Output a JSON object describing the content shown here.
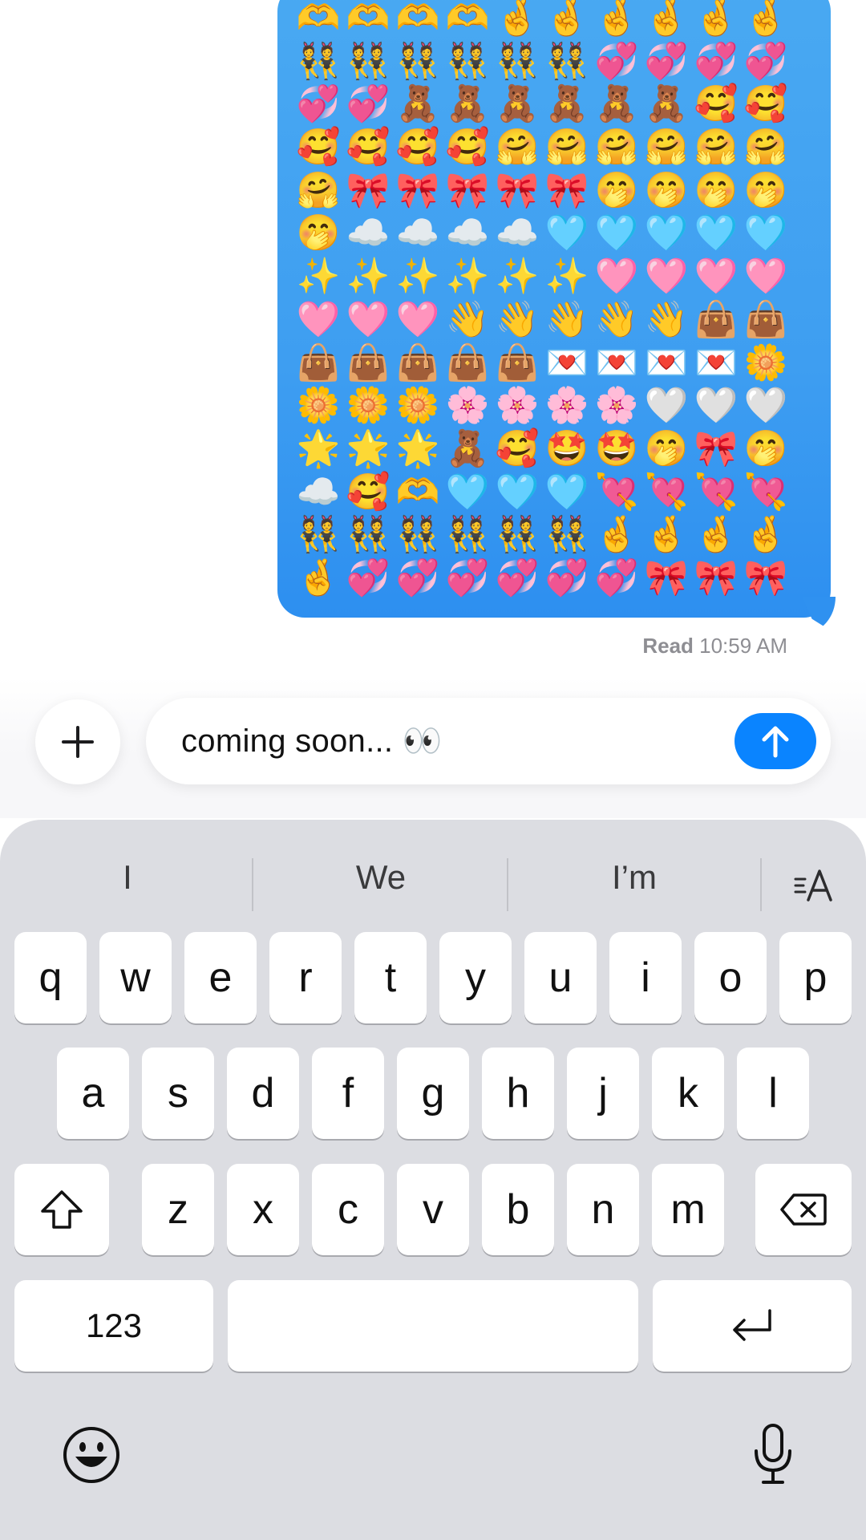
{
  "message": {
    "emoji_rows": [
      [
        "🫶",
        "🫶",
        "🫶",
        "🫶",
        "🤞",
        "🤞",
        "🤞",
        "🤞",
        "🤞",
        "🤞"
      ],
      [
        "👯",
        "👯",
        "👯",
        "👯",
        "👯",
        "👯",
        "💞",
        "💞",
        "💞",
        "💞"
      ],
      [
        "💞",
        "💞",
        "🧸",
        "🧸",
        "🧸",
        "🧸",
        "🧸",
        "🧸",
        "🥰",
        "🥰"
      ],
      [
        "🥰",
        "🥰",
        "🥰",
        "🥰",
        "🤗",
        "🤗",
        "🤗",
        "🤗",
        "🤗",
        "🤗"
      ],
      [
        "🤗",
        "🎀",
        "🎀",
        "🎀",
        "🎀",
        "🎀",
        "🤭",
        "🤭",
        "🤭",
        "🤭"
      ],
      [
        "🤭",
        "☁️",
        "☁️",
        "☁️",
        "☁️",
        "🩵",
        "🩵",
        "🩵",
        "🩵",
        "🩵"
      ],
      [
        "✨",
        "✨",
        "✨",
        "✨",
        "✨",
        "✨",
        "🩷",
        "🩷",
        "🩷",
        "🩷"
      ],
      [
        "🩷",
        "🩷",
        "🩷",
        "👋",
        "👋",
        "👋",
        "👋",
        "👋",
        "👜",
        "👜"
      ],
      [
        "👜",
        "👜",
        "👜",
        "👜",
        "👜",
        "💌",
        "💌",
        "💌",
        "💌",
        "🌼"
      ],
      [
        "🌼",
        "🌼",
        "🌼",
        "🌸",
        "🌸",
        "🌸",
        "🌸",
        "🤍",
        "🤍",
        "🤍"
      ],
      [
        "🌟",
        "🌟",
        "🌟",
        "🧸",
        "🥰",
        "🤩",
        "🤩",
        "🤭",
        "🎀",
        "🤭"
      ],
      [
        "☁️",
        "🥰",
        "🫶",
        "🩵",
        "🩵",
        "🩵",
        "💘",
        "💘",
        "💘",
        "💘"
      ],
      [
        "👯",
        "👯",
        "👯",
        "👯",
        "👯",
        "👯",
        "🤞",
        "🤞",
        "🤞",
        "🤞"
      ],
      [
        "🤞",
        "💞",
        "💞",
        "💞",
        "💞",
        "💞",
        "💞",
        "🎀",
        "🎀",
        "🎀"
      ]
    ],
    "read_label": "Read",
    "read_time": "10:59 AM"
  },
  "composer": {
    "plus_icon": "plus-icon",
    "input_text": "coming soon... 👀",
    "send_icon": "arrow-up-icon"
  },
  "keyboard": {
    "predictions": [
      "I",
      "We",
      "I’m"
    ],
    "format_icon": "text-format-icon",
    "row1": [
      "q",
      "w",
      "e",
      "r",
      "t",
      "y",
      "u",
      "i",
      "o",
      "p"
    ],
    "row2": [
      "a",
      "s",
      "d",
      "f",
      "g",
      "h",
      "j",
      "k",
      "l"
    ],
    "row3": [
      "z",
      "x",
      "c",
      "v",
      "b",
      "n",
      "m"
    ],
    "numbers_label": "123",
    "shift_icon": "shift-icon",
    "delete_icon": "delete-icon",
    "return_icon": "return-icon",
    "emoji_icon": "emoji-icon",
    "mic_icon": "microphone-icon",
    "colors": {
      "send": "#0a84ff",
      "bubble": "#3e9ef1",
      "keyboard_bg": "#dcdde2"
    }
  }
}
